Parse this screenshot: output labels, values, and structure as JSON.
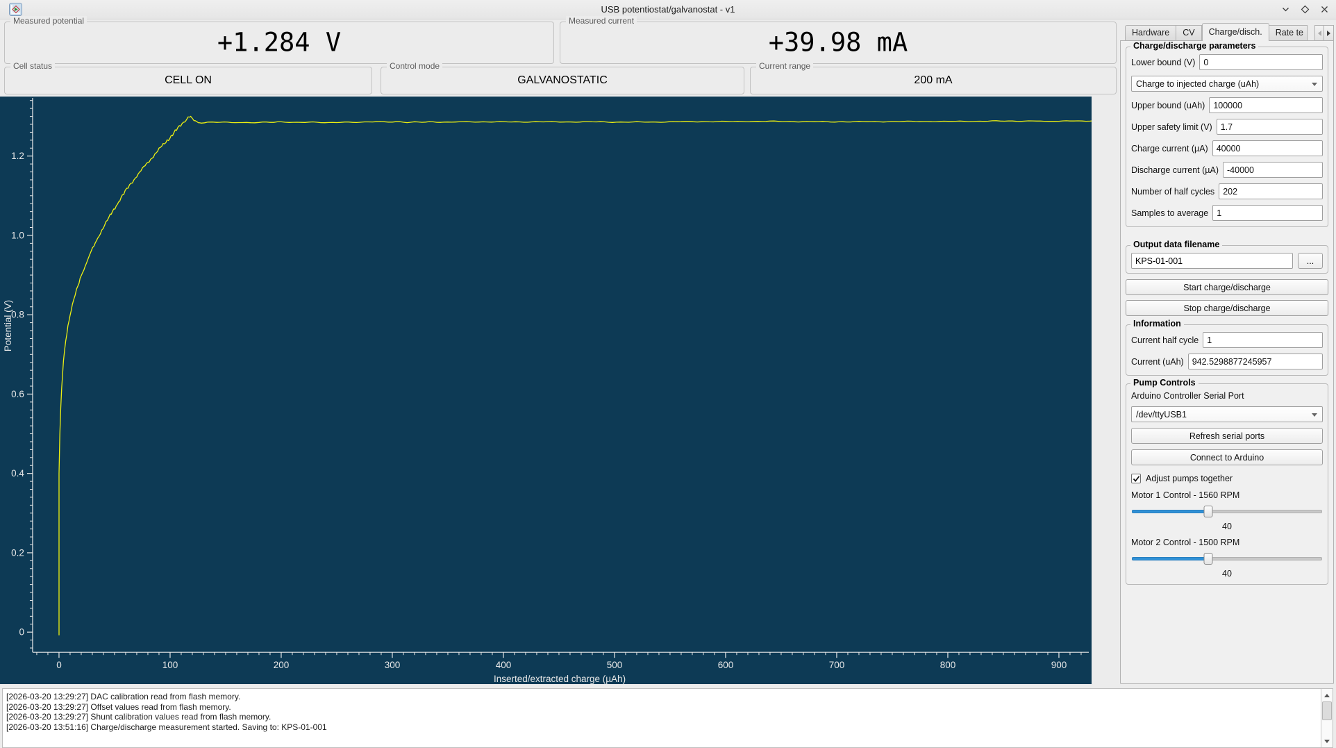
{
  "window": {
    "title": "USB potentiostat/galvanostat - v1"
  },
  "measurements": {
    "potential": {
      "label": "Measured potential",
      "value": "+1.284 V"
    },
    "current": {
      "label": "Measured current",
      "value": "+39.98 mA"
    },
    "cell_status": {
      "label": "Cell status",
      "value": "CELL ON"
    },
    "control_mode": {
      "label": "Control mode",
      "value": "GALVANOSTATIC"
    },
    "current_range": {
      "label": "Current range",
      "value": "200 mA"
    }
  },
  "tab_bar": {
    "tabs": [
      {
        "label": "Hardware",
        "active": false,
        "truncated": false
      },
      {
        "label": "CV",
        "active": false,
        "truncated": false
      },
      {
        "label": "Charge/disch.",
        "active": true,
        "truncated": false
      },
      {
        "label": "Rate te",
        "active": false,
        "truncated": true
      }
    ]
  },
  "charge_params": {
    "title": "Charge/discharge parameters",
    "lower_bound": {
      "label": "Lower bound (V)",
      "value": "0"
    },
    "mode_dropdown": {
      "value": "Charge to injected charge (uAh)"
    },
    "rows": [
      {
        "label": "Upper bound (uAh)",
        "value": "100000"
      },
      {
        "label": "Upper safety limit (V)",
        "value": "1.7"
      },
      {
        "label": "Charge current (µA)",
        "value": "40000"
      },
      {
        "label": "Discharge current (µA)",
        "value": "-40000"
      },
      {
        "label": "Number of half cycles",
        "value": "202"
      },
      {
        "label": "Samples to average",
        "value": "1"
      }
    ]
  },
  "output_file": {
    "title": "Output data filename",
    "filename": "KPS-01-001",
    "browse_label": "..."
  },
  "actions": {
    "start": "Start charge/discharge",
    "stop": "Stop charge/discharge"
  },
  "information": {
    "title": "Information",
    "rows": [
      {
        "label": "Current half cycle",
        "value": "1"
      },
      {
        "label": "Current (uAh)",
        "value": "942.5298877245957"
      }
    ]
  },
  "pump_controls": {
    "title": "Pump Controls",
    "serial_label": "Arduino Controller Serial Port",
    "serial_port": "/dev/ttyUSB1",
    "refresh_label": "Refresh serial ports",
    "connect_label": "Connect to Arduino",
    "adjust_together": {
      "label": "Adjust pumps together",
      "checked": true
    },
    "motor1": {
      "label": "Motor 1 Control - 1560 RPM",
      "value": "40",
      "percent": 40
    },
    "motor2": {
      "label": "Motor 2 Control - 1500 RPM",
      "value": "40",
      "percent": 40
    }
  },
  "chart_data": {
    "type": "line",
    "title": "",
    "xlabel": "Inserted/extracted charge (µAh)",
    "ylabel": "Potential (V)",
    "xlim": [
      -53.1,
      929.4
    ],
    "ylim": [
      -0.131,
      1.35
    ],
    "x_ticks": [
      0,
      100,
      200,
      300,
      400,
      500,
      600,
      700,
      800,
      900
    ],
    "y_ticks": [
      0,
      0.2,
      0.4,
      0.6,
      0.8,
      1.0,
      1.2
    ],
    "x_minor_step": 10,
    "y_minor_step": 0.02,
    "grid": false,
    "background": "#0d3a55",
    "line_color": "#eef011",
    "axis_color": "#e8e8e8",
    "series": [
      {
        "name": "Potential",
        "points": [
          [
            0,
            -0.008
          ],
          [
            0,
            0.4
          ],
          [
            0.8,
            0.5
          ],
          [
            1.6,
            0.565
          ],
          [
            2.4,
            0.615
          ],
          [
            3.2,
            0.652
          ],
          [
            4,
            0.682
          ],
          [
            5,
            0.712
          ],
          [
            6,
            0.735
          ],
          [
            7,
            0.754
          ],
          [
            8,
            0.771
          ],
          [
            9,
            0.786
          ],
          [
            10,
            0.8
          ],
          [
            12,
            0.823
          ],
          [
            14.5,
            0.85
          ],
          [
            17,
            0.872
          ],
          [
            20,
            0.9
          ],
          [
            23.5,
            0.922
          ],
          [
            27.5,
            0.95
          ],
          [
            31.5,
            0.974
          ],
          [
            36,
            1.0
          ],
          [
            41,
            1.026
          ],
          [
            46,
            1.05
          ],
          [
            51.5,
            1.075
          ],
          [
            57,
            1.1
          ],
          [
            63.5,
            1.126
          ],
          [
            70,
            1.15
          ],
          [
            77.5,
            1.176
          ],
          [
            85,
            1.2
          ],
          [
            92.5,
            1.225
          ],
          [
            101,
            1.25
          ],
          [
            107,
            1.27
          ],
          [
            112,
            1.285
          ],
          [
            115,
            1.294
          ],
          [
            117.5,
            1.301
          ],
          [
            119.5,
            1.295
          ],
          [
            121.5,
            1.289
          ],
          [
            124,
            1.285
          ],
          [
            128,
            1.2835
          ],
          [
            134,
            1.285
          ],
          [
            142,
            1.2855
          ],
          [
            152,
            1.2845
          ],
          [
            165,
            1.285
          ],
          [
            180,
            1.2855
          ],
          [
            200,
            1.285
          ],
          [
            225,
            1.2855
          ],
          [
            250,
            1.285
          ],
          [
            275,
            1.2855
          ],
          [
            300,
            1.286
          ],
          [
            330,
            1.2855
          ],
          [
            360,
            1.286
          ],
          [
            400,
            1.2855
          ],
          [
            440,
            1.286
          ],
          [
            480,
            1.2865
          ],
          [
            520,
            1.286
          ],
          [
            560,
            1.2865
          ],
          [
            600,
            1.2865
          ],
          [
            640,
            1.287
          ],
          [
            680,
            1.2865
          ],
          [
            720,
            1.287
          ],
          [
            760,
            1.2875
          ],
          [
            800,
            1.287
          ],
          [
            840,
            1.2875
          ],
          [
            880,
            1.288
          ],
          [
            910,
            1.288
          ],
          [
            942.5,
            1.2885
          ]
        ]
      }
    ]
  },
  "log": {
    "lines": [
      "[2026-03-20 13:29:27] DAC calibration read from flash memory.",
      "[2026-03-20 13:29:27] Offset values read from flash memory.",
      "[2026-03-20 13:29:27] Shunt calibration values read from flash memory.",
      "[2026-03-20 13:51:16] Charge/discharge measurement started. Saving to: KPS-01-001"
    ]
  }
}
